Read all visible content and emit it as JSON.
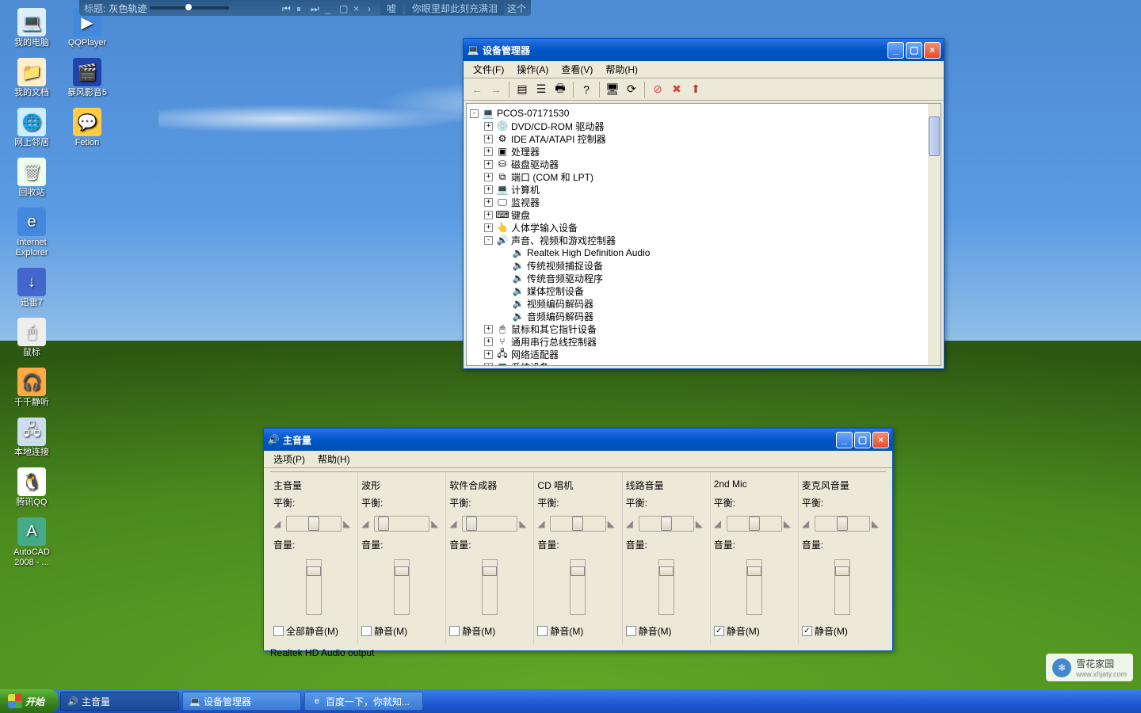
{
  "player": {
    "title_label": "标题:",
    "title": "灰色轨迹",
    "lyric_prefix": "嘘",
    "lyric": "你眼里却此刻充满泪",
    "lyric_suffix": "这个"
  },
  "desktop_icons_col1": [
    {
      "name": "my-computer",
      "label": "我的电脑",
      "glyph": "💻",
      "bg": "#ddeeff"
    },
    {
      "name": "my-documents",
      "label": "我的文档",
      "glyph": "📁",
      "bg": "#ffeecc"
    },
    {
      "name": "network-places",
      "label": "网上邻居",
      "glyph": "🌐",
      "bg": "#cceeff"
    },
    {
      "name": "recycle-bin",
      "label": "回收站",
      "glyph": "🗑",
      "bg": "#eeffee"
    },
    {
      "name": "internet-explorer",
      "label": "Internet Explorer",
      "glyph": "e",
      "bg": "#4488dd"
    },
    {
      "name": "xunlei7",
      "label": "迅雷7",
      "glyph": "↓",
      "bg": "#4466cc"
    },
    {
      "name": "mouse",
      "label": "鼠标",
      "glyph": "🖱",
      "bg": "#eeeeee"
    },
    {
      "name": "qianqian",
      "label": "千千静听",
      "glyph": "🎧",
      "bg": "#ffaa44"
    },
    {
      "name": "local-connection",
      "label": "本地连接",
      "glyph": "🖧",
      "bg": "#ccddee"
    },
    {
      "name": "tencent-qq",
      "label": "腾讯QQ",
      "glyph": "🐧",
      "bg": "#ffffff"
    },
    {
      "name": "autocad",
      "label": "AutoCAD 2008 - ...",
      "glyph": "A",
      "bg": "#44aa88"
    }
  ],
  "desktop_icons_col2": [
    {
      "name": "qqplayer",
      "label": "QQPlayer",
      "glyph": "▶",
      "bg": "#4488dd"
    },
    {
      "name": "baofeng",
      "label": "暴风影音5",
      "glyph": "🎬",
      "bg": "#2244aa"
    },
    {
      "name": "fetion",
      "label": "Fetion",
      "glyph": "💬",
      "bg": "#ffcc44"
    }
  ],
  "devmgr": {
    "title": "设备管理器",
    "menus": [
      "文件(F)",
      "操作(A)",
      "查看(V)",
      "帮助(H)"
    ],
    "root": "PCOS-07171530",
    "items": [
      {
        "label": "DVD/CD-ROM 驱动器",
        "glyph": "💿"
      },
      {
        "label": "IDE ATA/ATAPI 控制器",
        "glyph": "⚙"
      },
      {
        "label": "处理器",
        "glyph": "▣"
      },
      {
        "label": "磁盘驱动器",
        "glyph": "⛁"
      },
      {
        "label": "端口 (COM 和 LPT)",
        "glyph": "⧉"
      },
      {
        "label": "计算机",
        "glyph": "💻"
      },
      {
        "label": "监视器",
        "glyph": "🖵"
      },
      {
        "label": "键盘",
        "glyph": "⌨"
      },
      {
        "label": "人体学输入设备",
        "glyph": "👆"
      }
    ],
    "sound_label": "声音、视频和游戏控制器",
    "sound_children": [
      "Realtek High Definition Audio",
      "传统视频捕捉设备",
      "传统音频驱动程序",
      "媒体控制设备",
      "视频编码解码器",
      "音频编码解码器"
    ],
    "items_after": [
      {
        "label": "鼠标和其它指针设备",
        "glyph": "🖱"
      },
      {
        "label": "通用串行总线控制器",
        "glyph": "⑂"
      },
      {
        "label": "网络适配器",
        "glyph": "🖧"
      },
      {
        "label": "系统设备",
        "glyph": "💻"
      }
    ]
  },
  "vol": {
    "title": "主音量",
    "menus": [
      "选项(P)",
      "帮助(H)"
    ],
    "channels": [
      {
        "name": "主音量",
        "mute_label": "全部静音(M)",
        "muted": false,
        "balance": "center"
      },
      {
        "name": "波形",
        "mute_label": "静音(M)",
        "muted": false,
        "balance": "left"
      },
      {
        "name": "软件合成器",
        "mute_label": "静音(M)",
        "muted": false,
        "balance": "left"
      },
      {
        "name": "CD 唱机",
        "mute_label": "静音(M)",
        "muted": false,
        "balance": "center"
      },
      {
        "name": "线路音量",
        "mute_label": "静音(M)",
        "muted": false,
        "balance": "center"
      },
      {
        "name": "2nd Mic",
        "mute_label": "静音(M)",
        "muted": true,
        "balance": "center"
      },
      {
        "name": "麦克风音量",
        "mute_label": "静音(M)",
        "muted": true,
        "balance": "center"
      }
    ],
    "balance_label": "平衡:",
    "volume_label": "音量:",
    "footer": "Realtek HD Audio output"
  },
  "taskbar": {
    "start": "开始",
    "items": [
      {
        "label": "主音量",
        "glyph": "🔊",
        "active": true
      },
      {
        "label": "设备管理器",
        "glyph": "💻",
        "active": false
      },
      {
        "label": "百度一下，你就知...",
        "glyph": "e",
        "active": false
      }
    ]
  },
  "watermark": {
    "main": "雪花家园",
    "sub": "www.xhjaty.com",
    "glyph": "❄"
  }
}
